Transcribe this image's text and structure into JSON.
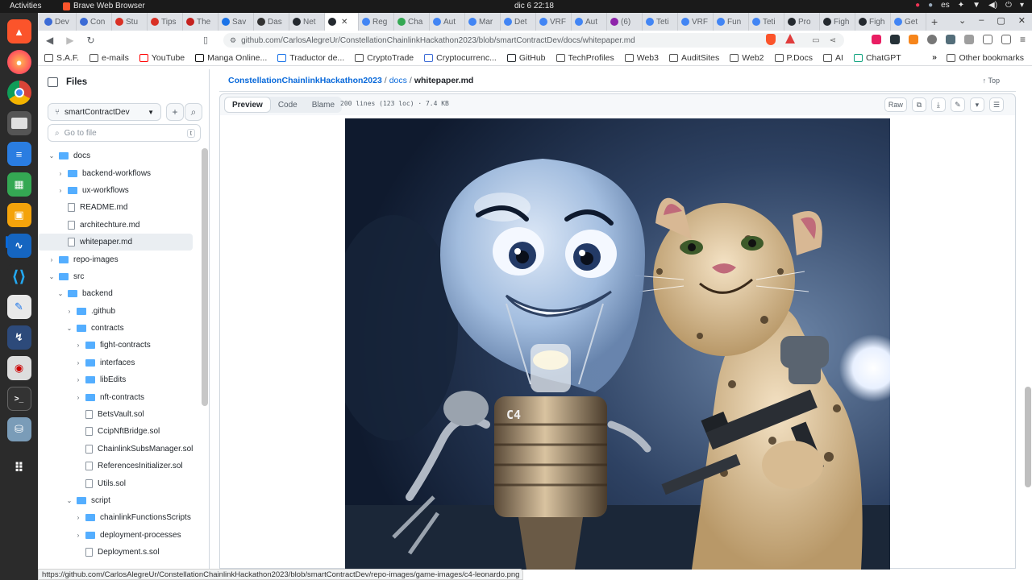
{
  "system": {
    "activities": "Activities",
    "app_name": "Brave Web Browser",
    "clock": "dic 6  22:18",
    "lang": "es"
  },
  "tabs": [
    {
      "label": "Dev",
      "color": "#3b6bd6"
    },
    {
      "label": "Con",
      "color": "#3b6bd6"
    },
    {
      "label": "Stu",
      "color": "#d93025"
    },
    {
      "label": "Tips",
      "color": "#d93025"
    },
    {
      "label": "The",
      "color": "#c5221f"
    },
    {
      "label": "Sav",
      "color": "#1a73e8"
    },
    {
      "label": "Das",
      "color": "#333333"
    },
    {
      "label": "Net",
      "color": "#24292f"
    },
    {
      "label": "",
      "color": "#24292f",
      "active": true
    },
    {
      "label": "Reg",
      "color": "#4285f4"
    },
    {
      "label": "Cha",
      "color": "#34a853"
    },
    {
      "label": "Aut",
      "color": "#4285f4"
    },
    {
      "label": "Mar",
      "color": "#4285f4"
    },
    {
      "label": "Det",
      "color": "#4285f4"
    },
    {
      "label": "VRF",
      "color": "#4285f4"
    },
    {
      "label": "Aut",
      "color": "#4285f4"
    },
    {
      "label": "(6)",
      "color": "#8e24aa"
    },
    {
      "label": "Teti",
      "color": "#4285f4"
    },
    {
      "label": "VRF",
      "color": "#4285f4"
    },
    {
      "label": "Fun",
      "color": "#4285f4"
    },
    {
      "label": "Teti",
      "color": "#4285f4"
    },
    {
      "label": "Pro",
      "color": "#24292f"
    },
    {
      "label": "Figh",
      "color": "#24292f"
    },
    {
      "label": "Figh",
      "color": "#24292f"
    },
    {
      "label": "Get",
      "color": "#4285f4"
    }
  ],
  "address": {
    "url": "github.com/CarlosAlegreUr/ConstellationChainlinkHackathon2023/blob/smartContractDev/docs/whitepaper.md"
  },
  "bookmarks": [
    {
      "label": "S.A.F."
    },
    {
      "label": "e-mails"
    },
    {
      "label": "YouTube"
    },
    {
      "label": "Manga Online..."
    },
    {
      "label": "Traductor de..."
    },
    {
      "label": "CryptoTrade"
    },
    {
      "label": "Cryptocurrenc..."
    },
    {
      "label": "GitHub"
    },
    {
      "label": "TechProfiles"
    },
    {
      "label": "Web3"
    },
    {
      "label": "AuditSites"
    },
    {
      "label": "Web2"
    },
    {
      "label": "P.Docs"
    },
    {
      "label": "AI"
    },
    {
      "label": "ChatGPT"
    }
  ],
  "bookmarks_more": "»",
  "other_bookmarks": "Other bookmarks",
  "sidebar": {
    "title": "Files",
    "branch": "smartContractDev",
    "search_placeholder": "Go to file",
    "search_kbd": "t",
    "tree": [
      {
        "label": "docs",
        "type": "folder",
        "depth": 0,
        "open": true
      },
      {
        "label": "backend-workflows",
        "type": "folder",
        "depth": 1,
        "open": false
      },
      {
        "label": "ux-workflows",
        "type": "folder",
        "depth": 1,
        "open": false
      },
      {
        "label": "README.md",
        "type": "file",
        "depth": 1
      },
      {
        "label": "architechture.md",
        "type": "file",
        "depth": 1
      },
      {
        "label": "whitepaper.md",
        "type": "file",
        "depth": 1,
        "selected": true
      },
      {
        "label": "repo-images",
        "type": "folder",
        "depth": 0,
        "open": false
      },
      {
        "label": "src",
        "type": "folder",
        "depth": 0,
        "open": true
      },
      {
        "label": "backend",
        "type": "folder",
        "depth": 1,
        "open": true
      },
      {
        "label": ".github",
        "type": "folder",
        "depth": 2,
        "open": false
      },
      {
        "label": "contracts",
        "type": "folder",
        "depth": 2,
        "open": true
      },
      {
        "label": "fight-contracts",
        "type": "folder",
        "depth": 3,
        "open": false
      },
      {
        "label": "interfaces",
        "type": "folder",
        "depth": 3,
        "open": false
      },
      {
        "label": "libEdits",
        "type": "folder",
        "depth": 3,
        "open": false
      },
      {
        "label": "nft-contracts",
        "type": "folder",
        "depth": 3,
        "open": false
      },
      {
        "label": "BetsVault.sol",
        "type": "file",
        "depth": 3
      },
      {
        "label": "CcipNftBridge.sol",
        "type": "file",
        "depth": 3
      },
      {
        "label": "ChainlinkSubsManager.sol",
        "type": "file",
        "depth": 3
      },
      {
        "label": "ReferencesInitializer.sol",
        "type": "file",
        "depth": 3
      },
      {
        "label": "Utils.sol",
        "type": "file",
        "depth": 3
      },
      {
        "label": "script",
        "type": "folder",
        "depth": 2,
        "open": true
      },
      {
        "label": "chainlinkFunctionsScripts",
        "type": "folder",
        "depth": 3,
        "open": false
      },
      {
        "label": "deployment-processes",
        "type": "folder",
        "depth": 3,
        "open": false
      },
      {
        "label": "Deployment.s.sol",
        "type": "file",
        "depth": 3
      }
    ]
  },
  "breadcrumb": {
    "repo": "ConstellationChainlinkHackathon2023",
    "folder": "docs",
    "file": "whitepaper.md",
    "top": "Top"
  },
  "file_header": {
    "tabs": [
      "Preview",
      "Code",
      "Blame"
    ],
    "active_tab": "Preview",
    "meta": "200 lines (123 loc) · 7.4 KB",
    "raw": "Raw"
  },
  "image": {
    "bulb_label": "C4"
  },
  "status_url": "https://github.com/CarlosAlegreUr/ConstellationChainlinkHackathon2023/blob/smartContractDev/repo-images/game-images/c4-leonardo.png"
}
